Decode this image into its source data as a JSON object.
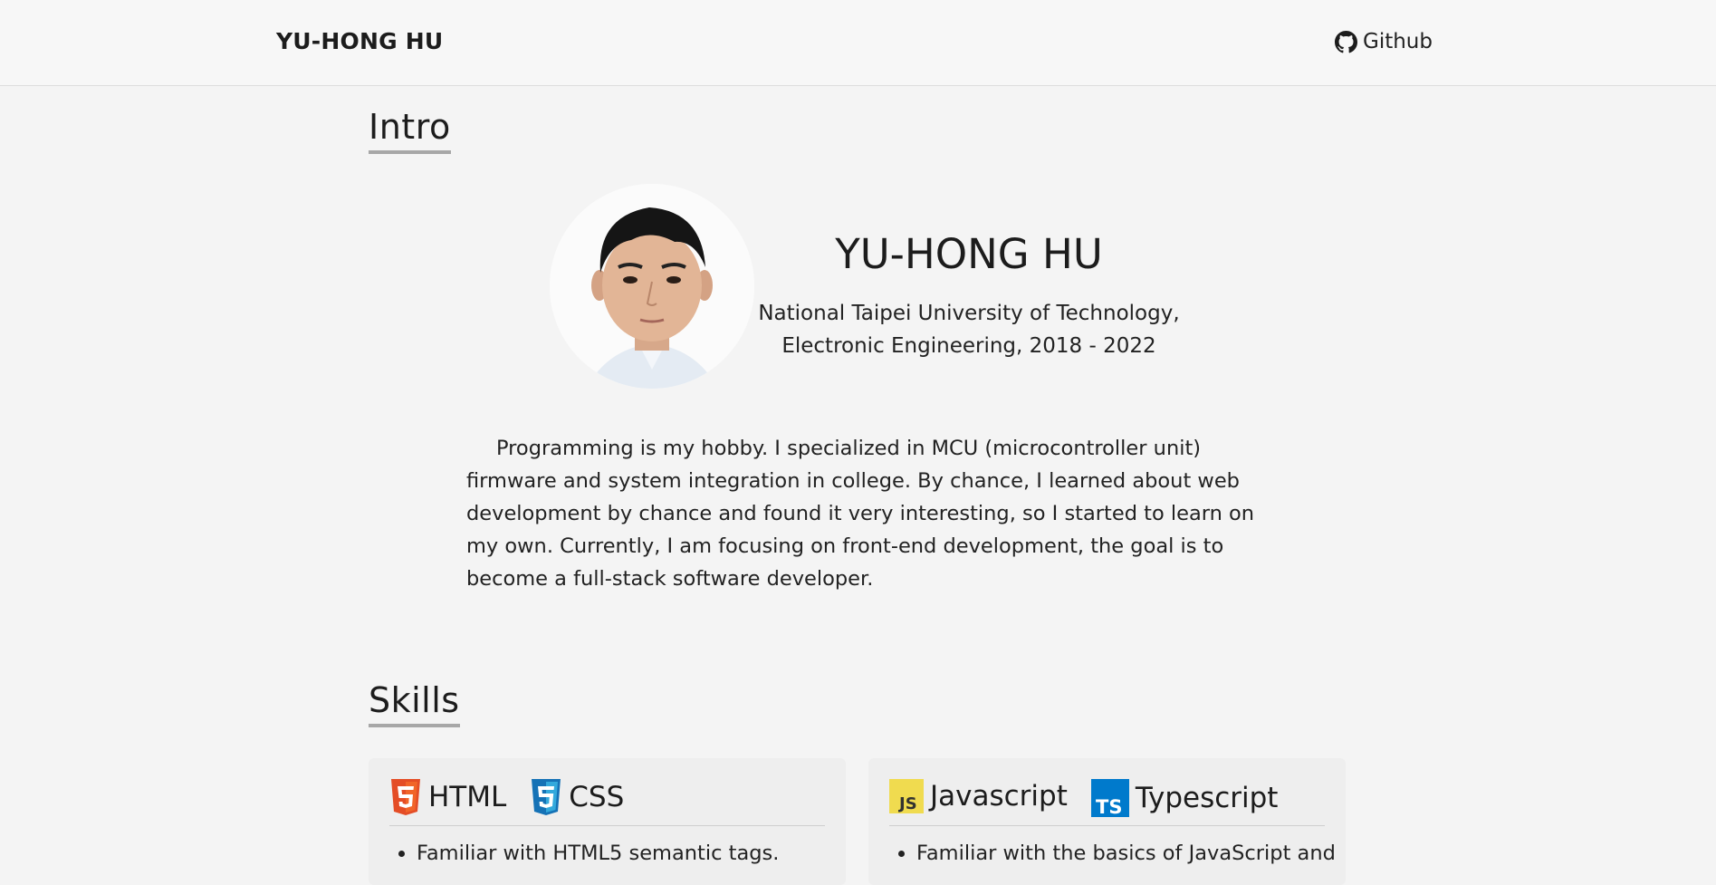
{
  "nav": {
    "brand": "YU-HONG HU",
    "github_label": "Github",
    "github_icon": "github-icon"
  },
  "intro": {
    "title": "Intro",
    "name": "YU-HONG HU",
    "education_line1": "National Taipei University of Technology,",
    "education_line2": "Electronic Engineering, 2018 - 2022",
    "paragraph": "Programming is my hobby. I specialized in MCU (microcontroller unit) firmware and system integration in college. By chance, I learned about web development by chance and found it very interesting, so I started to learn on my own. Currently, I am focusing on front-end development, the goal is to become a full-stack software developer."
  },
  "skills": {
    "title": "Skills",
    "cards": [
      {
        "techs": [
          {
            "label": "HTML",
            "icon": "html5-icon",
            "color": "#e44d26"
          },
          {
            "label": "CSS",
            "icon": "css3-icon",
            "color": "#1572b6"
          }
        ],
        "items": [
          "Familiar with HTML5 semantic tags."
        ]
      },
      {
        "techs": [
          {
            "label": "Javascript",
            "icon": "javascript-icon",
            "color": "#f0db4f"
          },
          {
            "label": "Typescript",
            "icon": "typescript-icon",
            "color": "#007acc"
          }
        ],
        "items": [
          "Familiar with the basics of JavaScript and"
        ]
      }
    ]
  },
  "colors": {
    "background": "#f4f4f4",
    "navbar": "#f7f7f7",
    "title_underline": "#a7a7a7",
    "card": "#eeeeee"
  }
}
